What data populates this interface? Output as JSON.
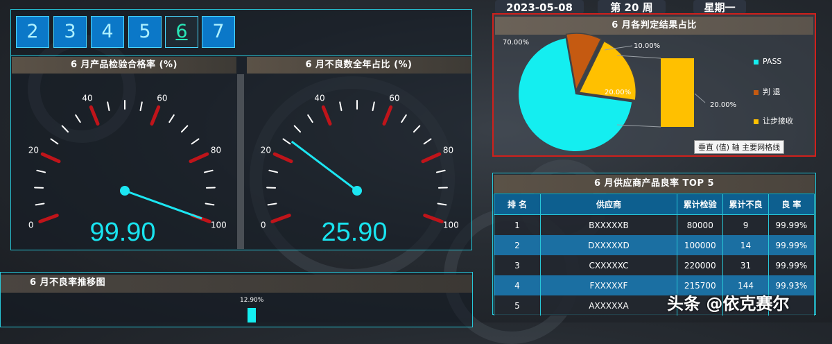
{
  "header": {
    "date": "2023-05-08",
    "week": "第 20 周",
    "weekday": "星期一"
  },
  "month_tabs": [
    {
      "label": "2",
      "active": false
    },
    {
      "label": "3",
      "active": false
    },
    {
      "label": "4",
      "active": false
    },
    {
      "label": "5",
      "active": false
    },
    {
      "label": "6",
      "active": true
    },
    {
      "label": "7",
      "active": false
    }
  ],
  "gauge1": {
    "title": "6 月产品检验合格率 (%)",
    "value_text": "99.90",
    "value": 99.9,
    "min": 0,
    "max": 100,
    "tick_labels": [
      "0",
      "20",
      "40",
      "60",
      "80",
      "100"
    ]
  },
  "gauge2": {
    "title": "6 月不良数全年占比 (%)",
    "value_text": "25.90",
    "value": 25.9,
    "min": 0,
    "max": 100,
    "tick_labels": [
      "0",
      "20",
      "40",
      "60",
      "80",
      "100"
    ]
  },
  "trend": {
    "title": "6 月不良率推移图",
    "label": "12.90%"
  },
  "pie": {
    "title": "6 月各判定结果占比",
    "tooltip": "垂直 (值) 轴 主要网格线",
    "colors": {
      "PASS": "#14eef0",
      "判 退": "#c55a11",
      "让步接收": "#ffc000"
    }
  },
  "chart_data": {
    "type": "pie",
    "title": "6 月各判定结果占比",
    "categories": [
      "PASS",
      "判 退",
      "让步接收"
    ],
    "values": [
      70,
      10,
      20
    ],
    "labels": [
      "70.00%",
      "10.00%",
      "20.00%"
    ],
    "bar_of_pie_label": "20.00%"
  },
  "supplier_table": {
    "title": "6 月供应商产品良率 TOP 5",
    "columns": [
      "排 名",
      "供应商",
      "累计检验",
      "累计不良",
      "良 率"
    ],
    "rows": [
      [
        "1",
        "BXXXXXB",
        "80000",
        "9",
        "99.99%"
      ],
      [
        "2",
        "DXXXXXD",
        "100000",
        "14",
        "99.99%"
      ],
      [
        "3",
        "CXXXXXC",
        "220000",
        "31",
        "99.99%"
      ],
      [
        "4",
        "FXXXXXF",
        "215700",
        "144",
        "99.93%"
      ],
      [
        "5",
        "AXXXXXA",
        "",
        "",
        ""
      ]
    ]
  },
  "watermark": "头条 @依克赛尔"
}
